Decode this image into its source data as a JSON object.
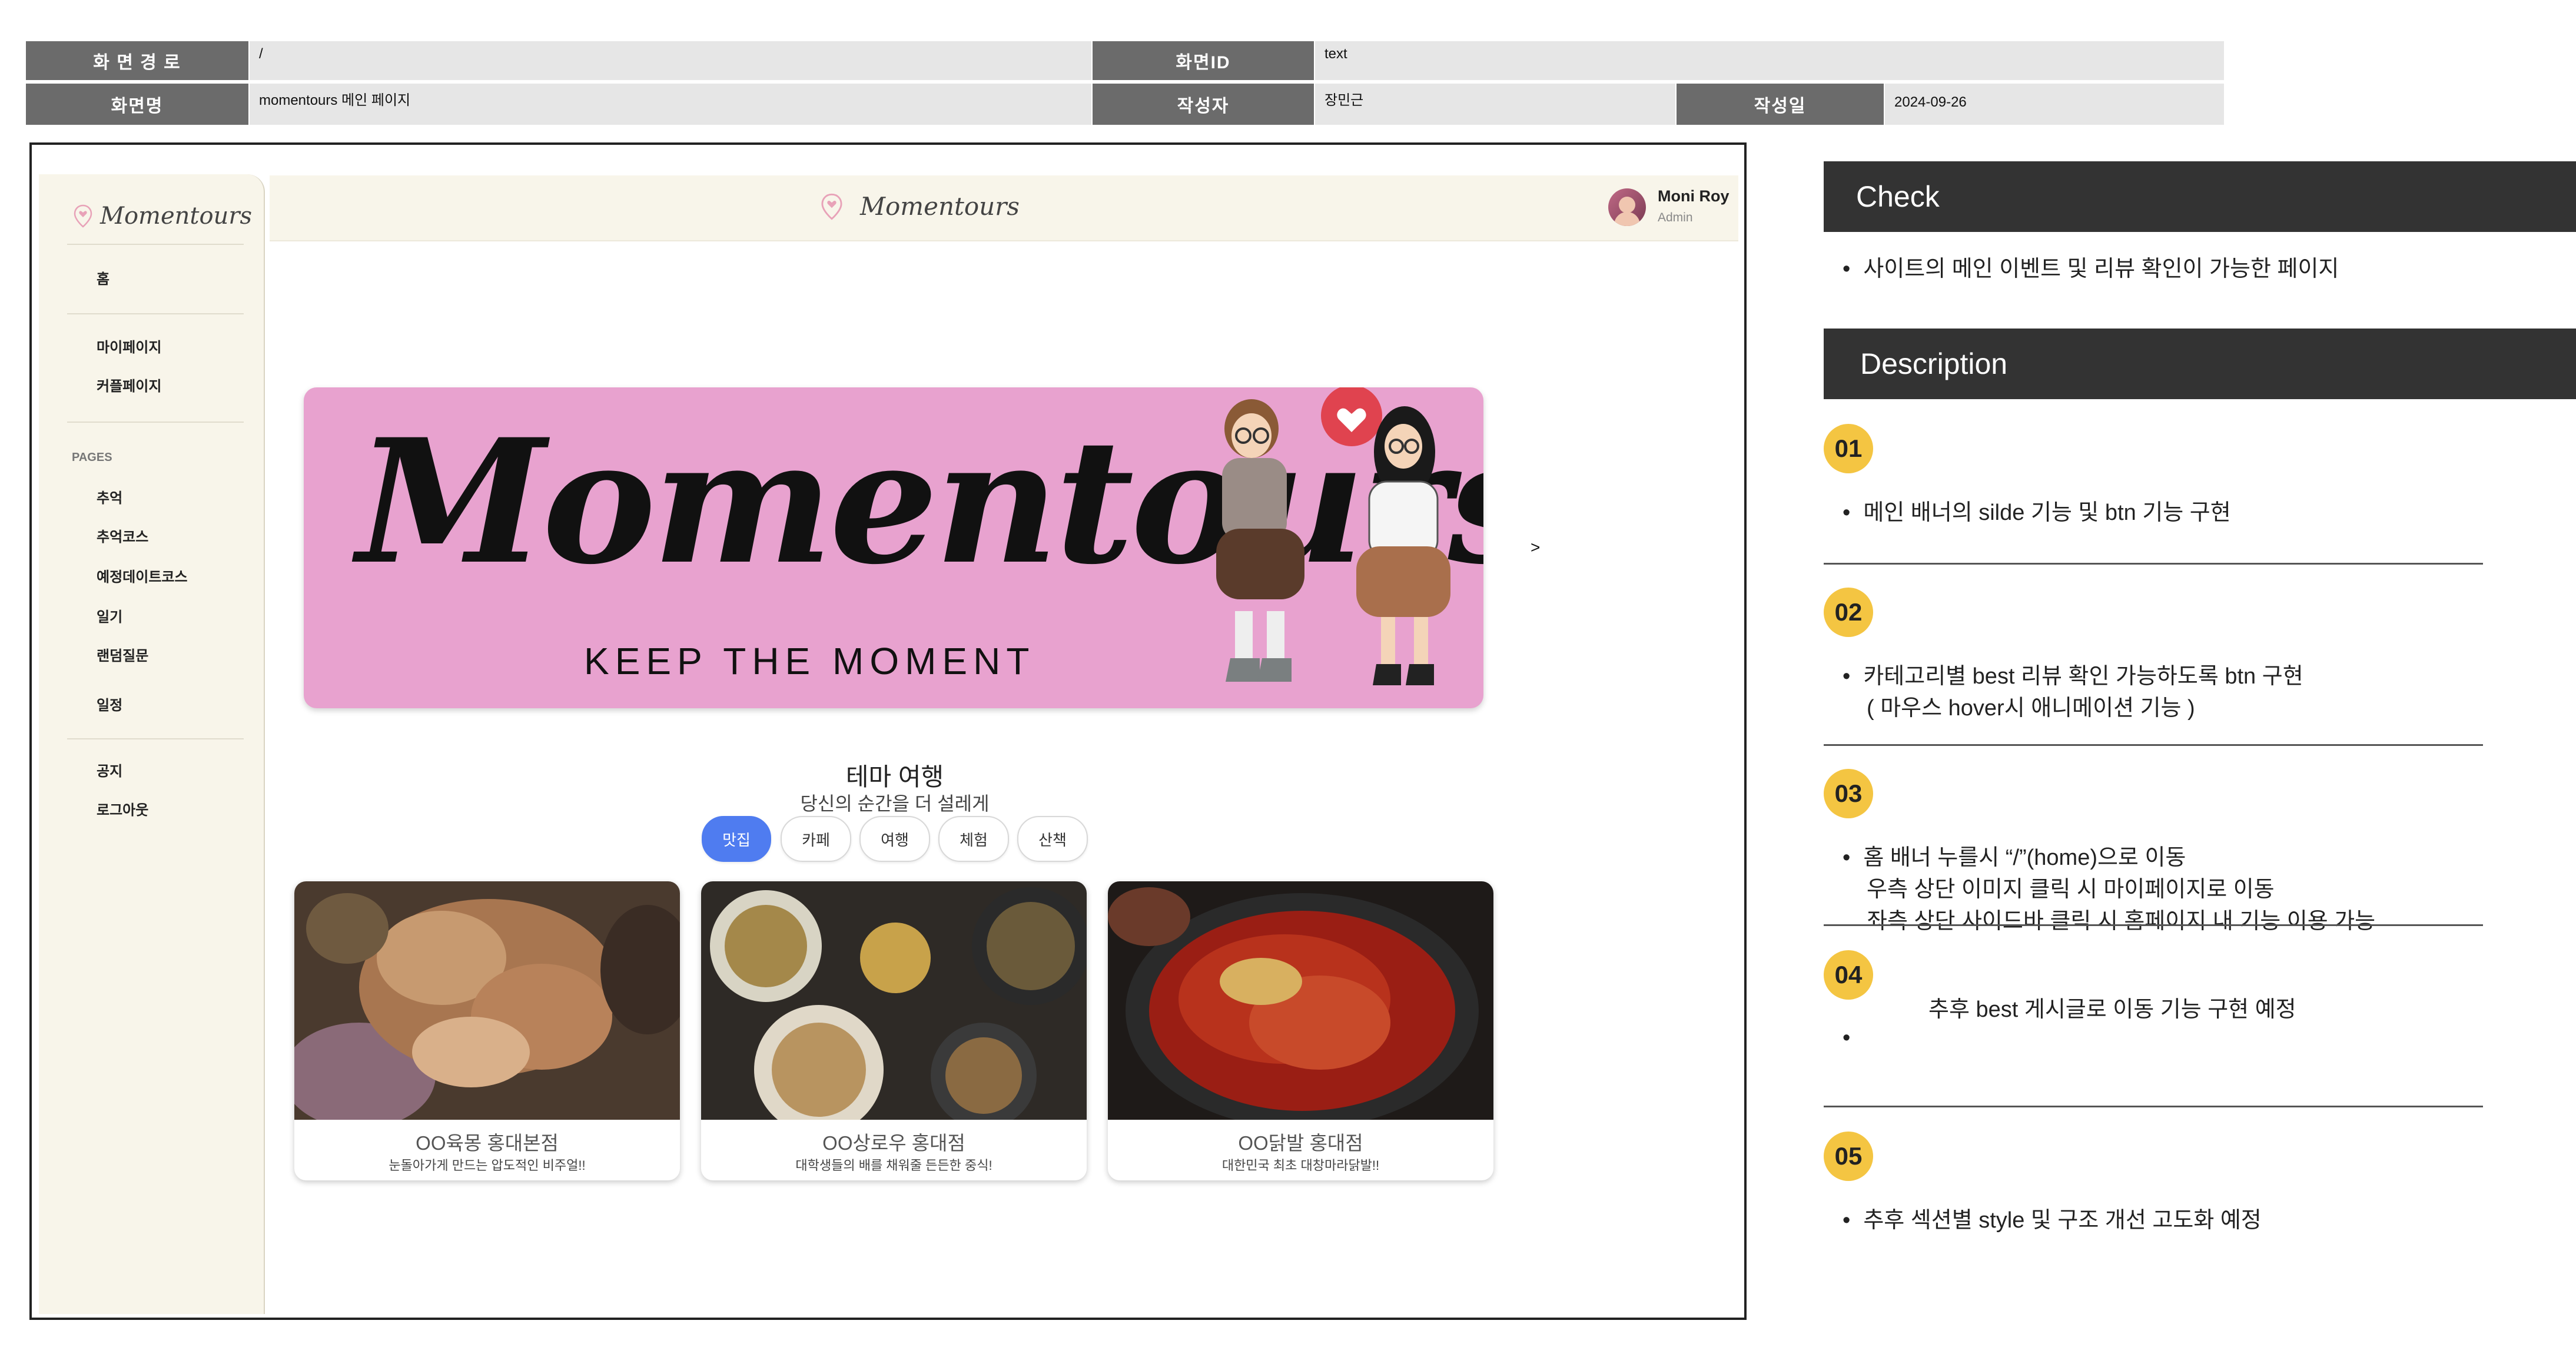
{
  "meta": {
    "path_label": "화 면 경 로",
    "path_value": "/",
    "screen_id_label": "화면ID",
    "screen_id_value": "text",
    "screen_name_label": "화면명",
    "screen_name_value": "momentours 메인 페이지",
    "author_label": "작성자",
    "author_value": "장민근",
    "date_label": "작성일",
    "date_value": "2024-09-26"
  },
  "app": {
    "sidebar_logo": "Momentours",
    "top_logo": "Momentours",
    "user_name": "Moni Roy",
    "user_role": "Admin",
    "sidebar": {
      "home": "홈",
      "mypage": "마이페이지",
      "couple": "커플페이지",
      "section": "PAGES",
      "memory": "추억",
      "memory_course": "추억코스",
      "planned_course": "예정데이트코스",
      "diary": "일기",
      "random_q": "랜덤질문",
      "schedule": "일정",
      "notice": "공지",
      "logout": "로그아웃"
    },
    "banner": {
      "title": "Momentours",
      "subtitle": "KEEP THE MOMENT",
      "next_arrow": ">"
    },
    "theme": {
      "title": "테마 여행",
      "subtitle": "당신의 순간을 더 설레게",
      "tabs": [
        "맛집",
        "카페",
        "여행",
        "체험",
        "산책"
      ]
    },
    "cards": [
      {
        "title": "OO육몽 홍대본점",
        "desc": "눈돌아가게 만드는 압도적인 비주얼!!"
      },
      {
        "title": "OO상로우 홍대점",
        "desc": "대학생들의 배를 채워줄 든든한 중식!"
      },
      {
        "title": "OO닭발 홍대점",
        "desc": "대한민국 최초 대창마라닭발!!"
      }
    ]
  },
  "panel": {
    "check_title": "Check",
    "check_bullet": "사이트의 메인 이벤트 및 리뷰 확인이 가능한 페이지",
    "desc_title": "Description",
    "items": [
      {
        "num": "01",
        "lines": [
          "메인 배너의 silde 기능 및 btn 기능 구현"
        ]
      },
      {
        "num": "02",
        "lines": [
          "카테고리별 best 리뷰 확인 가능하도록 btn 구현",
          "( 마우스 hover시 애니메이션 기능 )"
        ]
      },
      {
        "num": "03",
        "lines": [
          "홈 배너 누를시 “/”(home)으로 이동",
          "우측 상단 이미지 클릭 시 마이페이지로 이동",
          "좌측 상단 사이드바 클릭 시 홈페이지 내 기능 이용 가능"
        ]
      },
      {
        "num": "04",
        "lines": [
          "추후 best 게시글로 이동 기능 구현 예정"
        ]
      },
      {
        "num": "05",
        "lines": [
          "추후 섹션별 style 및 구조 개선 고도화 예정"
        ]
      }
    ]
  },
  "colors": {
    "label_bg": "#6b6b6b",
    "value_bg": "#e6e6e6",
    "sidebar_bg": "#f8f5ea",
    "banner_pink": "#e8a2cf",
    "active_tab": "#4f7cf0",
    "number_badge": "#f4c542",
    "panel_header": "#333333"
  },
  "icons": {
    "logo": "location-pin-heart-icon",
    "avatar": "user-avatar",
    "heart": "heart-icon"
  }
}
